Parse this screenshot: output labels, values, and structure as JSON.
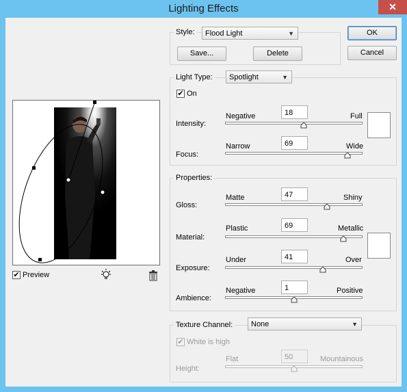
{
  "window": {
    "title": "Lighting Effects",
    "close_glyph": "✕"
  },
  "style_group": {
    "label": "Style:",
    "selected": "Flood Light",
    "save_label": "Save...",
    "delete_label": "Delete"
  },
  "dialog_buttons": {
    "ok_label": "OK",
    "cancel_label": "Cancel"
  },
  "light_type": {
    "label": "Light Type:",
    "selected": "Spotlight",
    "on_label": "On",
    "on_checked": true,
    "intensity": {
      "label": "Intensity:",
      "min_label": "Negative",
      "max_label": "Full",
      "value": "18",
      "fraction": 0.57
    },
    "focus": {
      "label": "Focus:",
      "min_label": "Narrow",
      "max_label": "Wide",
      "value": "69",
      "fraction": 0.89
    },
    "color": "#ffffff"
  },
  "properties": {
    "label": "Properties:",
    "gloss": {
      "label": "Gloss:",
      "min_label": "Matte",
      "max_label": "Shiny",
      "value": "47",
      "fraction": 0.74
    },
    "material": {
      "label": "Material:",
      "min_label": "Plastic",
      "max_label": "Metallic",
      "value": "69",
      "fraction": 0.86
    },
    "exposure": {
      "label": "Exposure:",
      "min_label": "Under",
      "max_label": "Over",
      "value": "41",
      "fraction": 0.71
    },
    "ambience": {
      "label": "Ambience:",
      "min_label": "Negative",
      "max_label": "Positive",
      "value": "1",
      "fraction": 0.5
    },
    "color": "#ffffff"
  },
  "texture": {
    "label": "Texture Channel:",
    "selected": "None",
    "white_is_high_label": "White is high",
    "white_is_high_checked": true,
    "height": {
      "label": "Height:",
      "min_label": "Flat",
      "max_label": "Mountainous",
      "value": "50",
      "fraction": 0.5
    }
  },
  "preview": {
    "label": "Preview",
    "checked": true,
    "light_icon": "lightbulb-icon",
    "delete_icon": "trash-icon"
  },
  "arrow_glyph": "▼",
  "check_glyph": "✔"
}
